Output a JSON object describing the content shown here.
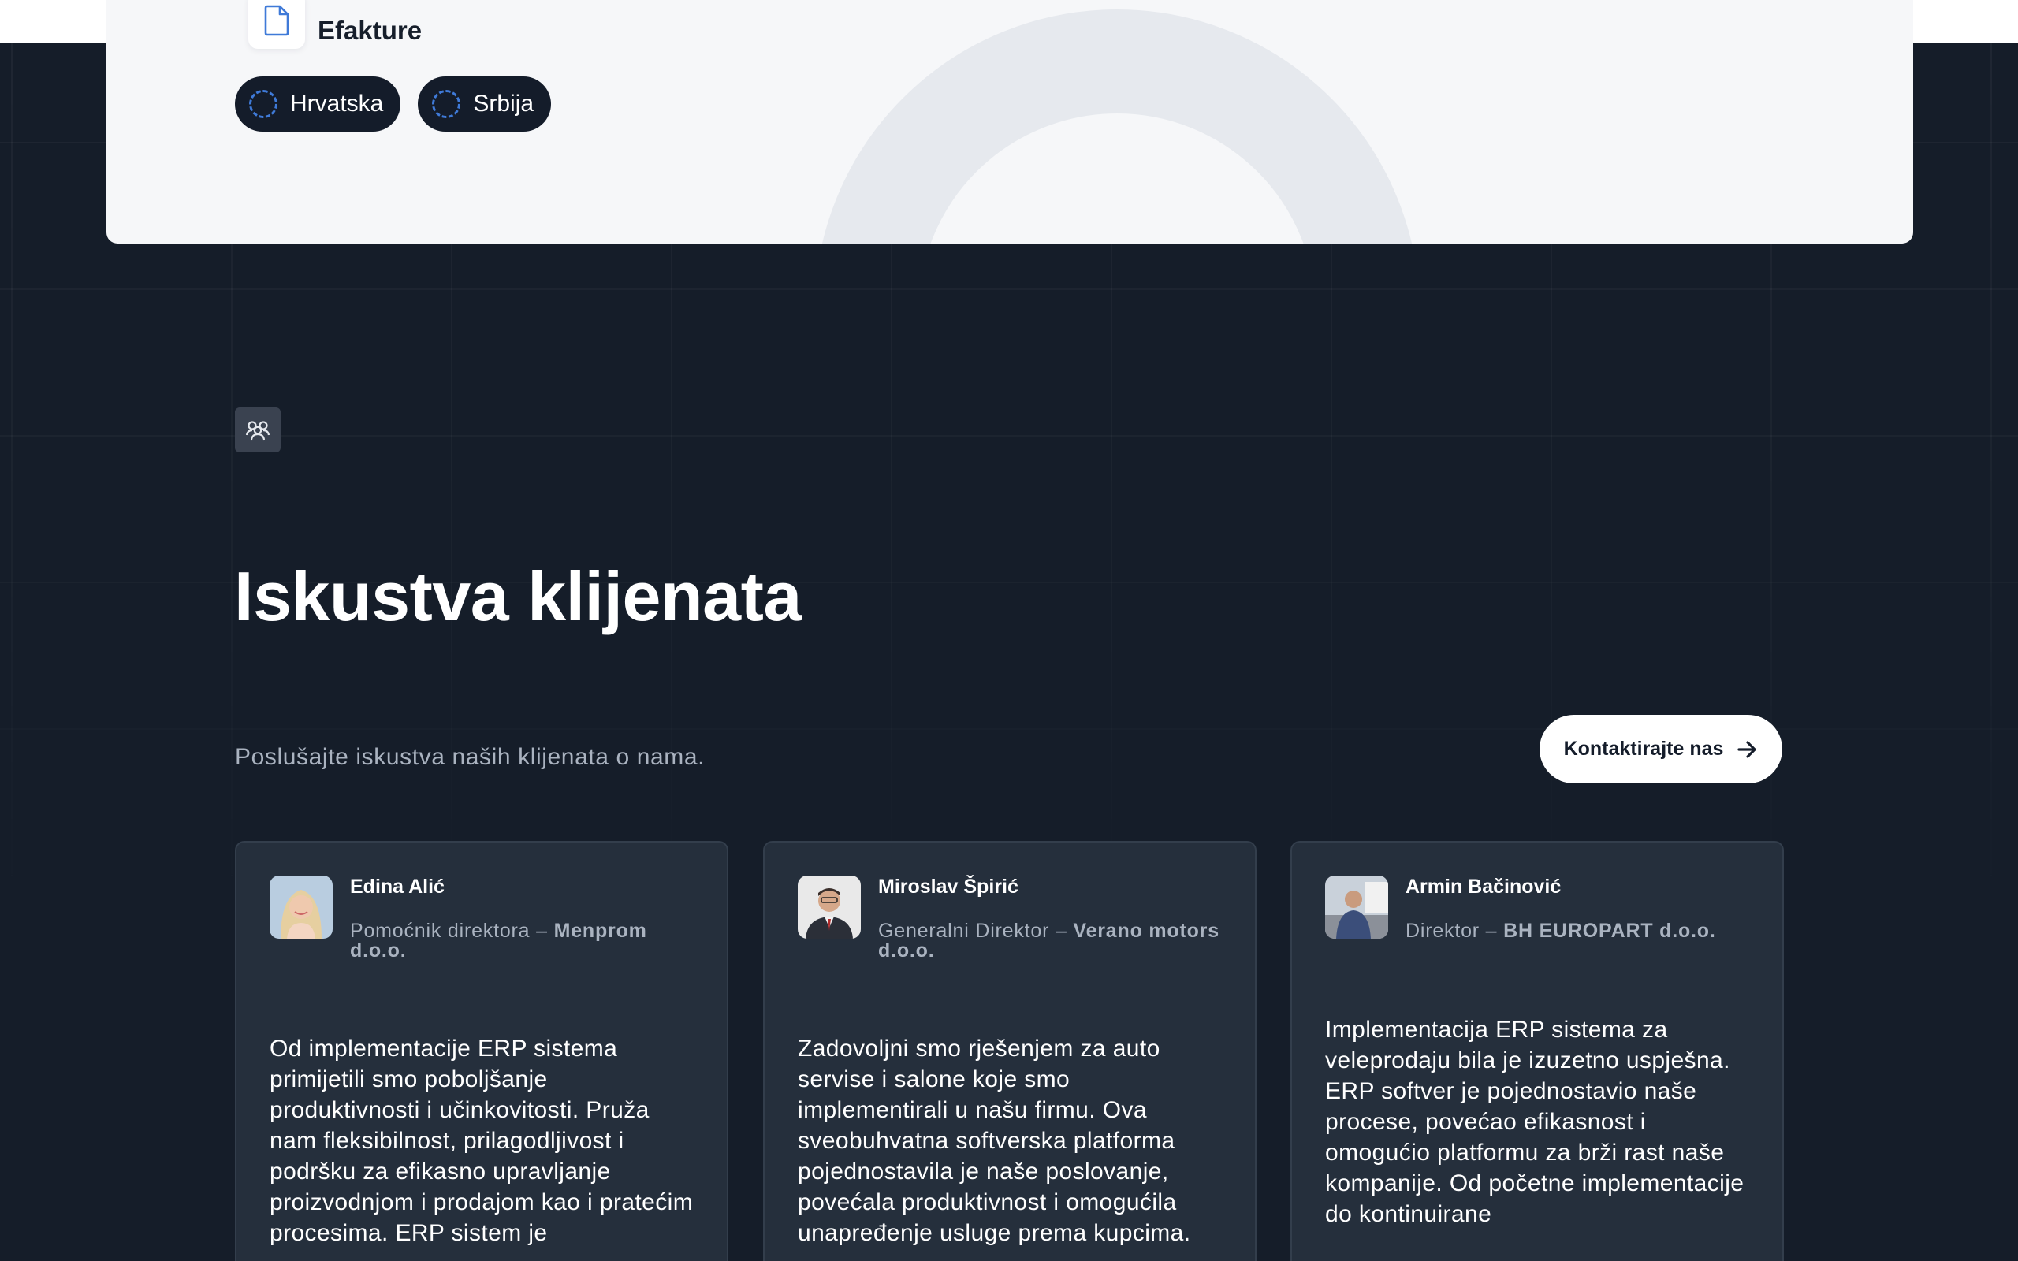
{
  "hero": {
    "title": "Efakture",
    "pills": [
      "Hrvatska",
      "Srbija"
    ]
  },
  "section": {
    "icon": "users-icon",
    "title": "Iskustva klijenata",
    "subtitle": "Poslušajte iskustva naših klijenata o nama.",
    "cta_label": "Kontaktirajte nas"
  },
  "testimonials": [
    {
      "name": "Edina Alić",
      "role": "Pomoćnik direktora –",
      "company": "Menprom d.o.o.",
      "quote": "Od implementacije ERP sistema primijetili smo poboljšanje produktivnosti i učinkovitosti. Pruža nam fleksibilnost, prilagodljivost i podršku za efikasno upravljanje proizvodnjom i prodajom kao i pratećim procesima. ERP sistem je"
    },
    {
      "name": "Miroslav Špirić",
      "role": "Generalni Direktor –",
      "company": "Verano motors d.o.o.",
      "quote": "Zadovoljni smo rješenjem za auto servise i salone koje smo implementirali u našu firmu. Ova sveobuhvatna softverska platforma pojednostavila je naše poslovanje, povećala produktivnost i omogućila unapređenje usluge prema kupcima."
    },
    {
      "name": "Armin Bačinović",
      "role": "Direktor –",
      "company": "BH EUROPART d.o.o.",
      "quote": "Implementacija ERP sistema za veleprodaju bila je izuzetno uspješna. ERP softver je pojednostavio naše procese, povećao efikasnost i omogućio platformu za brži rast naše kompanije. Od početne implementacije do kontinuirane"
    }
  ]
}
